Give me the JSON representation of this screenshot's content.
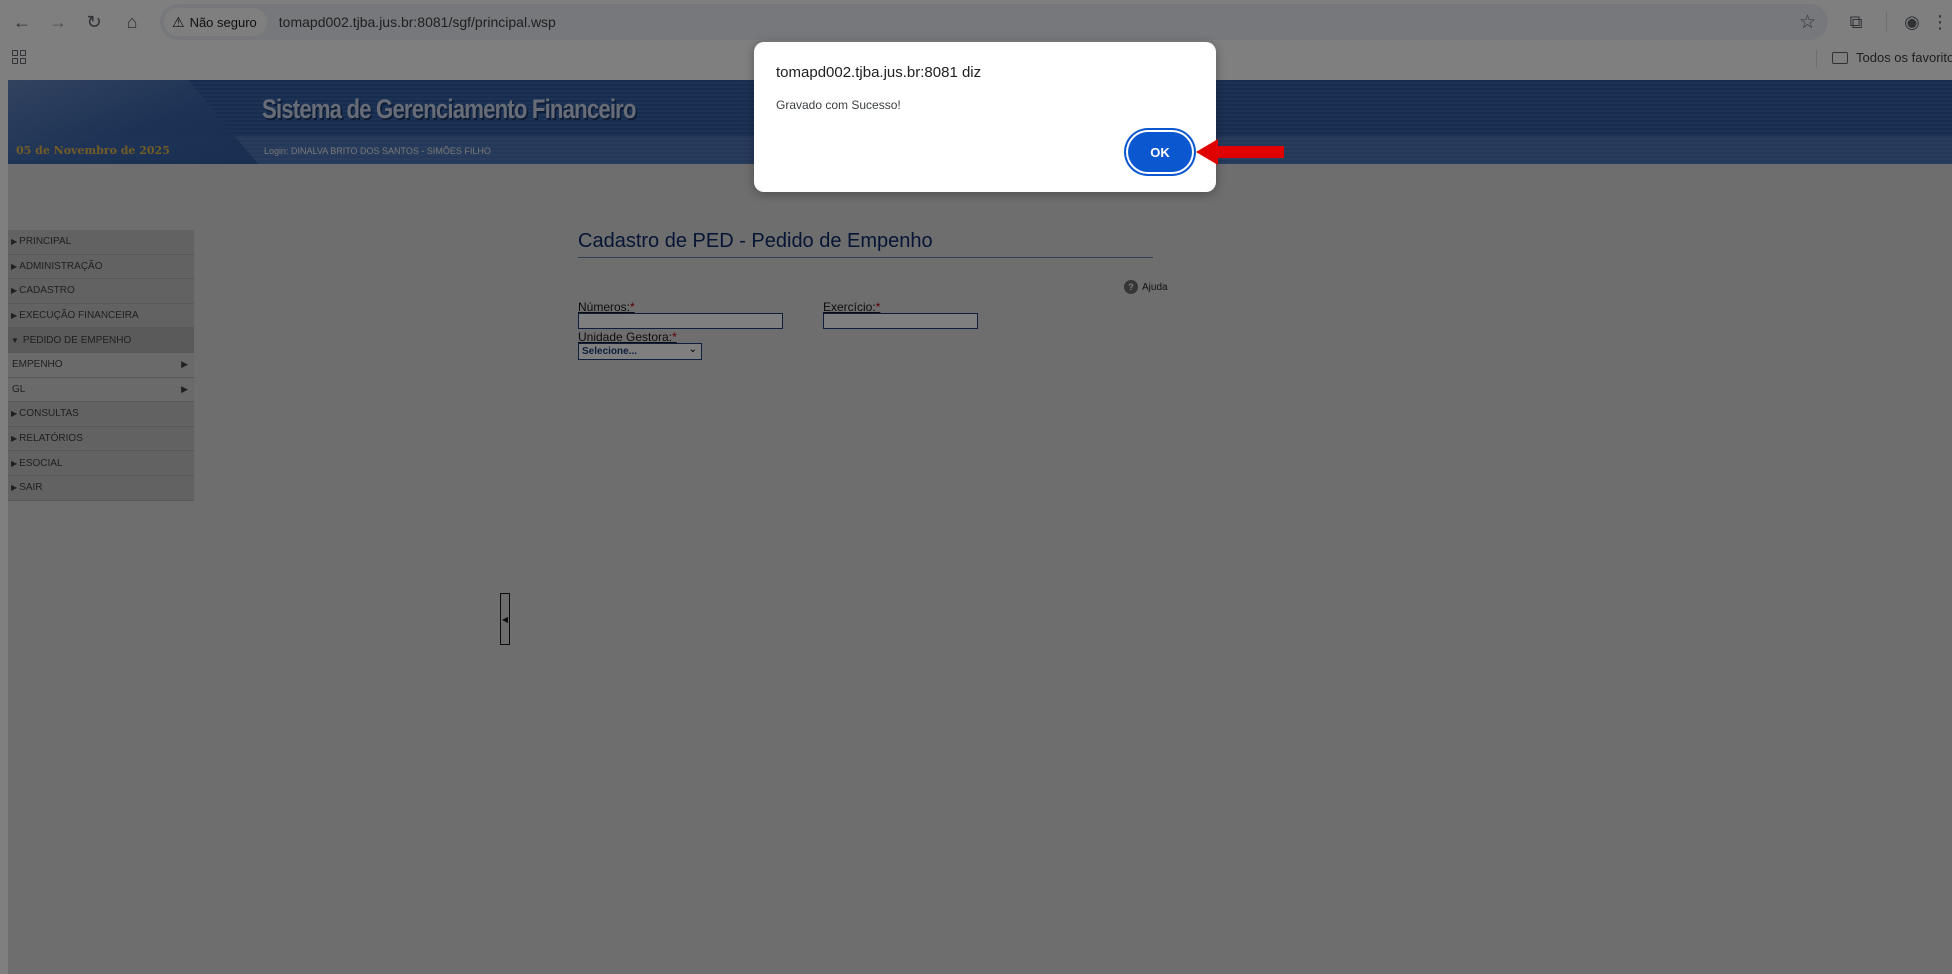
{
  "browser": {
    "security_label": "Não seguro",
    "url": "tomapd002.tjba.jus.br:8081/sgf/principal.wsp",
    "bookmark_folder": "Todos os favoritos",
    "icons": [
      "back-icon",
      "forward-icon",
      "reload-icon",
      "home-icon",
      "warning-icon",
      "star-icon",
      "extensions-icon",
      "profile-icon",
      "menu-icon",
      "apps-icon",
      "folder-icon"
    ]
  },
  "app": {
    "title": "Sistema de Gerenciamento Financeiro",
    "date": "05 de Novembro de 2025",
    "login": "Login: DINALVA BRITO DOS SANTOS - SIMÕES FILHO",
    "menu": [
      {
        "label": "PRINCIPAL"
      },
      {
        "label": "ADMINISTRAÇÃO"
      },
      {
        "label": "CADASTRO"
      },
      {
        "label": "EXECUÇÃO FINANCEIRA"
      },
      {
        "label": "PEDIDO DE EMPENHO"
      },
      {
        "label": "EMPENHO"
      },
      {
        "label": "GL"
      },
      {
        "label": "CONSULTAS"
      },
      {
        "label": "RELATÓRIOS"
      },
      {
        "label": "ESOCIAL"
      },
      {
        "label": "SAIR"
      }
    ]
  },
  "form": {
    "page_title": "Cadastro de PED - Pedido de Empenho",
    "help_label": "Ajuda",
    "numeros_label": "Números:",
    "exercicio_label": "Exercício:",
    "unidade_label": "Unidade Gestora:",
    "required_mark": "*",
    "unidade_selected": "Selecione..."
  },
  "dialog": {
    "title": "tomapd002.tjba.jus.br:8081 diz",
    "message": "Gravado com Sucesso!",
    "ok_label": "OK"
  },
  "colors": {
    "accent": "#0b57d0",
    "header_blue": "#2f5aa0",
    "annotation_arrow": "#e00000"
  }
}
